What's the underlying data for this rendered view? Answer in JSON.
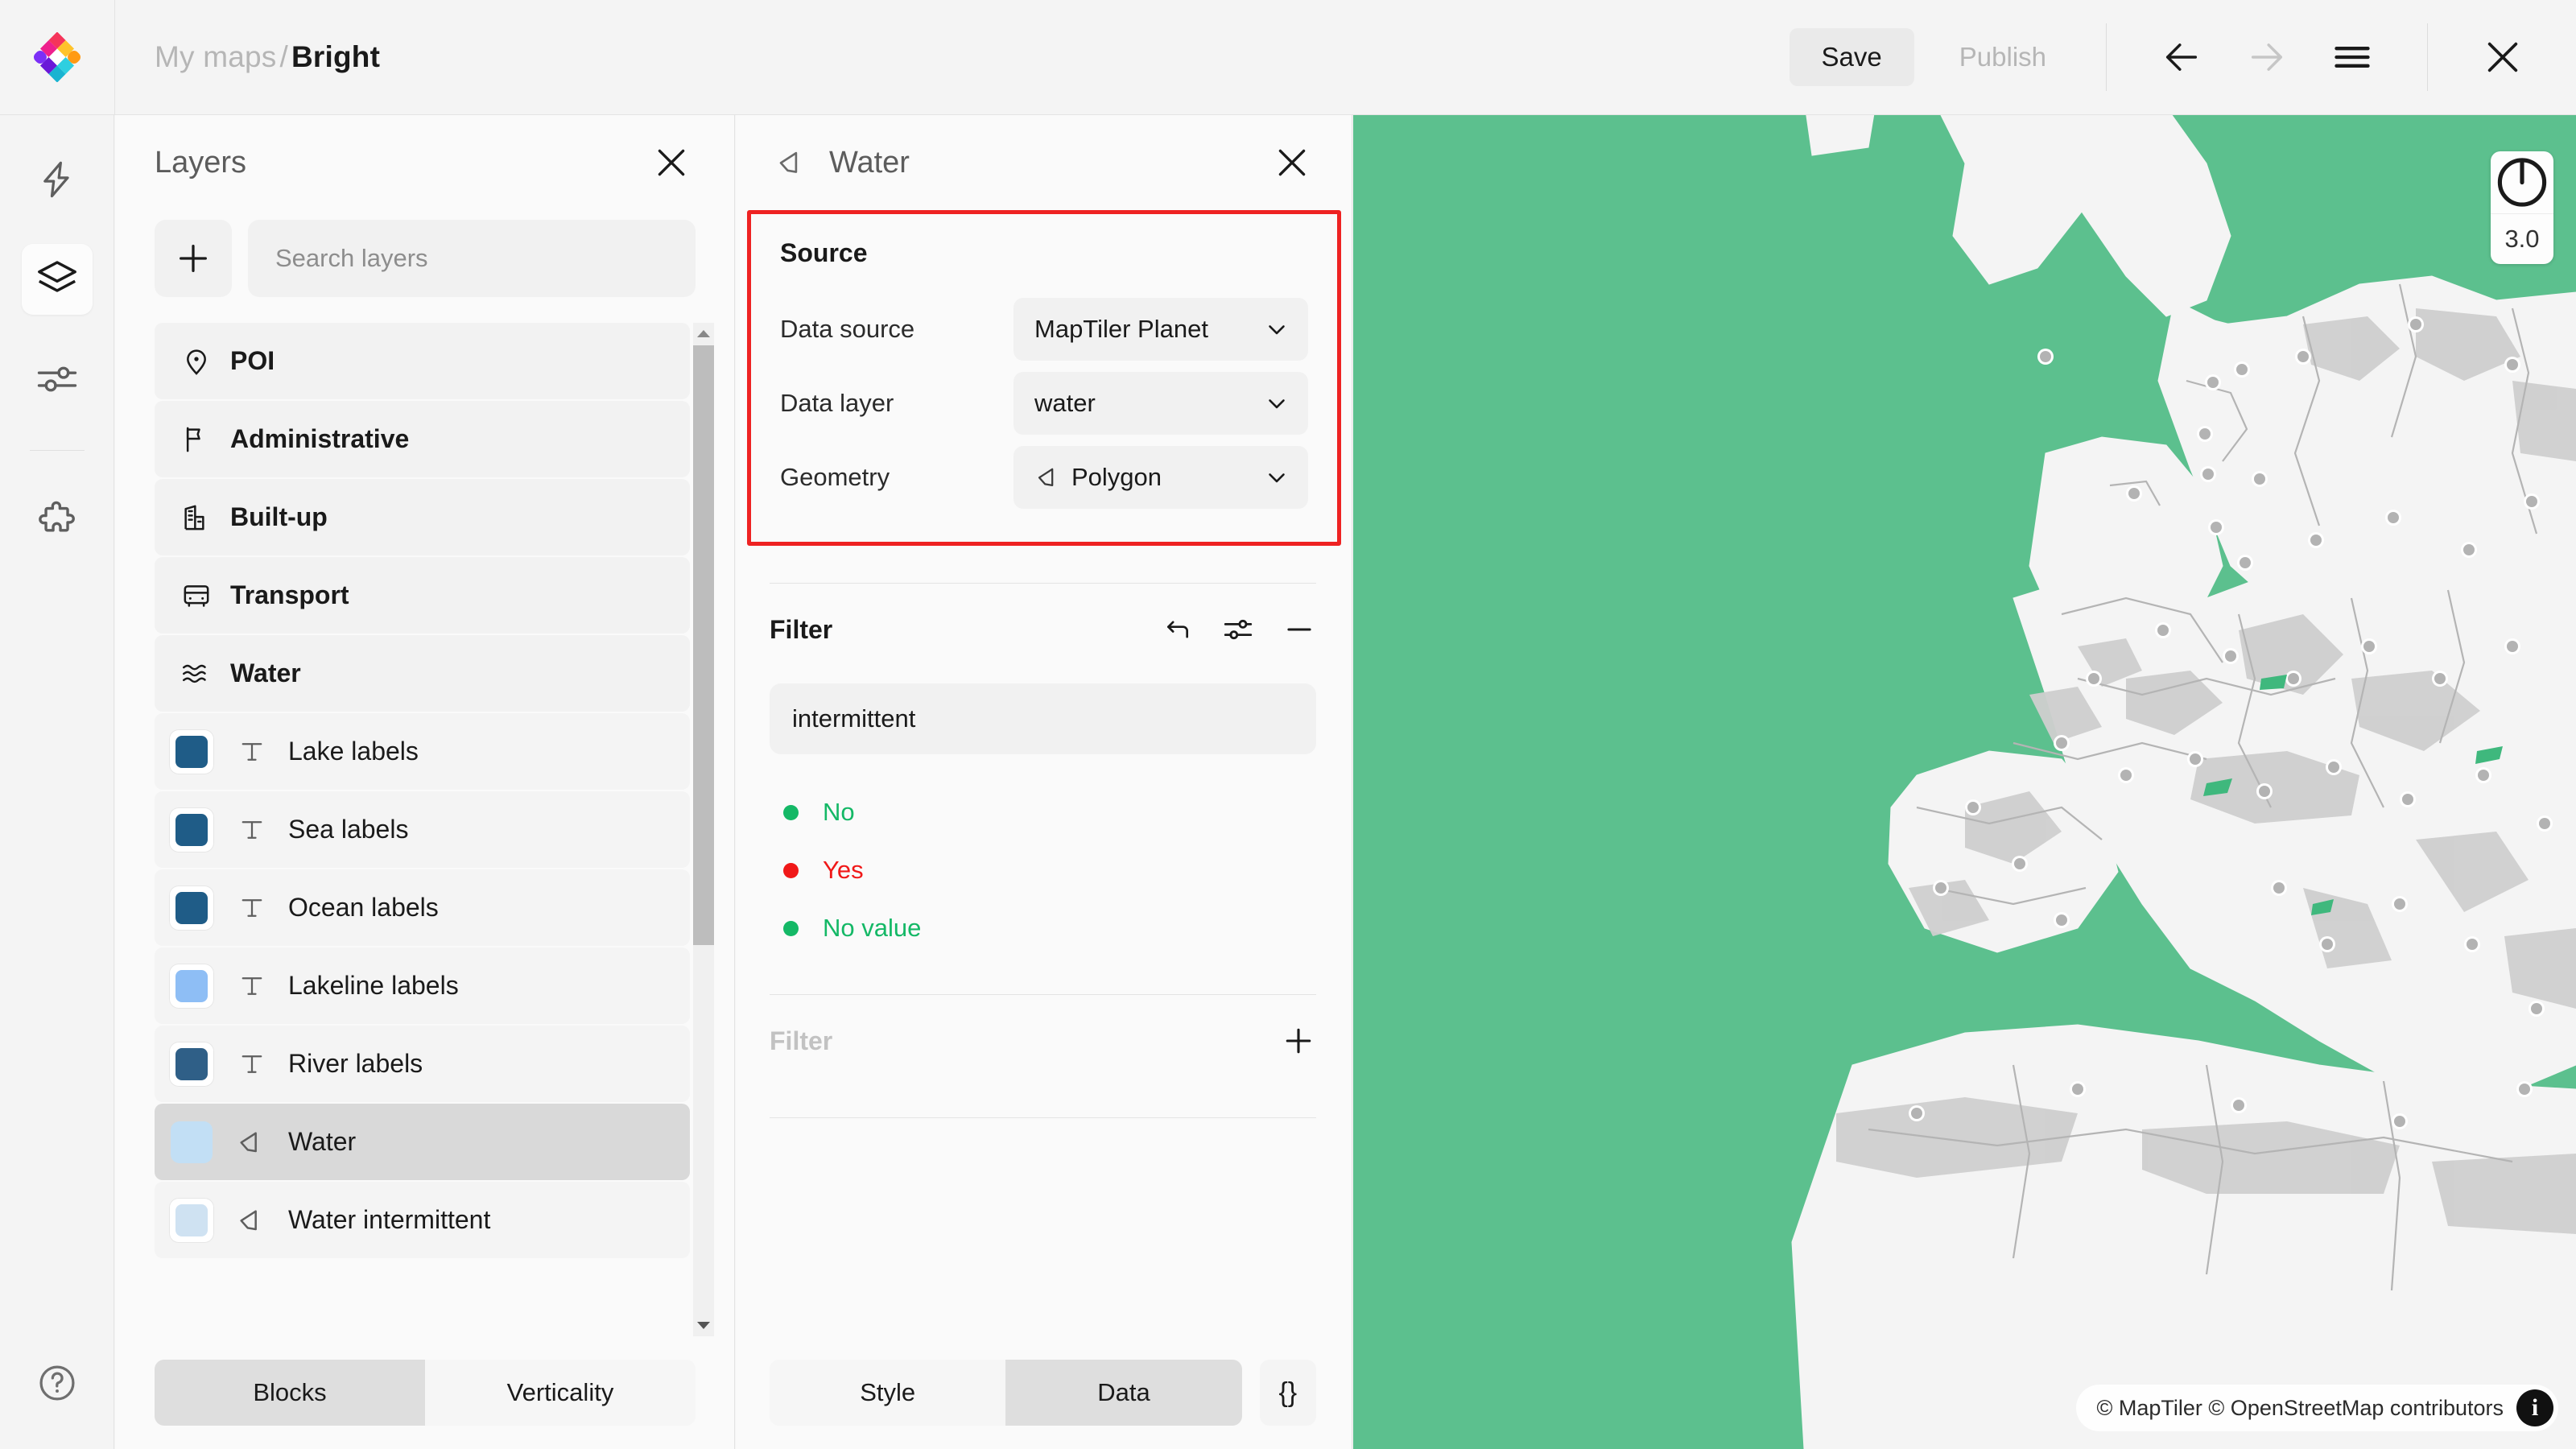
{
  "header": {
    "logo_icon": "maptiler-logo",
    "breadcrumb_root": "My maps",
    "breadcrumb_sep": "/",
    "breadcrumb_current": "Bright",
    "save_label": "Save",
    "publish_label": "Publish",
    "back_icon": "arrow-left-icon",
    "forward_icon": "arrow-right-icon",
    "menu_icon": "hamburger-menu-icon",
    "close_icon": "close-icon"
  },
  "rail": {
    "items": [
      {
        "name": "lightning-icon",
        "label": "Quick actions",
        "active": false
      },
      {
        "name": "layers-icon",
        "label": "Layers",
        "active": true
      },
      {
        "name": "sliders-icon",
        "label": "Settings",
        "active": false
      },
      {
        "name": "puzzle-icon",
        "label": "Plugins",
        "active": false
      }
    ],
    "help_icon": "help-circle-icon"
  },
  "layers_panel": {
    "title": "Layers",
    "close_icon": "close-icon",
    "add_icon": "plus-icon",
    "search_placeholder": "Search layers",
    "search_value": "",
    "groups": [
      {
        "label": "POI",
        "icon": "map-pin-icon"
      },
      {
        "label": "Administrative",
        "icon": "flag-icon"
      },
      {
        "label": "Built-up",
        "icon": "building-icon"
      },
      {
        "label": "Transport",
        "icon": "bus-icon"
      },
      {
        "label": "Water",
        "icon": "waves-icon"
      }
    ],
    "children": [
      {
        "label": "Lake labels",
        "icon": "text-icon",
        "color": "#1f5c87",
        "selected": false
      },
      {
        "label": "Sea labels",
        "icon": "text-icon",
        "color": "#1f5c87",
        "selected": false
      },
      {
        "label": "Ocean labels",
        "icon": "text-icon",
        "color": "#1f5c87",
        "selected": false
      },
      {
        "label": "Lakeline labels",
        "icon": "text-icon",
        "color": "#8ebef5",
        "selected": false
      },
      {
        "label": "River labels",
        "icon": "text-icon",
        "color": "#2f5f87",
        "selected": false
      },
      {
        "label": "Water",
        "icon": "polygon-icon",
        "color": "#c2dff5",
        "selected": true
      },
      {
        "label": "Water intermittent",
        "icon": "polygon-icon",
        "color": "#cfe2f2",
        "selected": false
      }
    ],
    "tabs": [
      {
        "label": "Blocks",
        "active": true
      },
      {
        "label": "Verticality",
        "active": false
      }
    ]
  },
  "detail_panel": {
    "icon": "polygon-icon",
    "title": "Water",
    "close_icon": "close-icon",
    "source": {
      "section_title": "Source",
      "highlight_color": "#ee2222",
      "fields": [
        {
          "label": "Data source",
          "value": "MapTiler Planet",
          "icon": "",
          "chevron": "chevron-down-icon"
        },
        {
          "label": "Data layer",
          "value": "water",
          "icon": "",
          "chevron": "chevron-down-icon"
        },
        {
          "label": "Geometry",
          "value": "Polygon",
          "icon": "polygon-icon",
          "chevron": "chevron-down-icon"
        }
      ]
    },
    "filter": {
      "title": "Filter",
      "undo_icon": "undo-arrow-icon",
      "settings_icon": "sliders-icon",
      "collapse_icon": "minus-icon",
      "field_value": "intermittent",
      "values": [
        {
          "label": "No",
          "color": "#14b866"
        },
        {
          "label": "Yes",
          "color": "#f01818"
        },
        {
          "label": "No value",
          "color": "#14b866"
        }
      ]
    },
    "filter_add": {
      "title": "Filter",
      "add_icon": "plus-icon"
    },
    "tabs": [
      {
        "label": "Style",
        "active": false
      },
      {
        "label": "Data",
        "active": true
      }
    ],
    "json_button": "{}"
  },
  "map": {
    "water_color": "#5cc08e",
    "land_color": "#f4f4f4",
    "landcover_color": "#cccccc",
    "border_color": "#b5b5b5",
    "compass_icon": "compass-icon",
    "zoom_level": "3.0",
    "attribution": "© MapTiler © OpenStreetMap contributors",
    "info_icon": "info-icon",
    "info_glyph": "i"
  }
}
